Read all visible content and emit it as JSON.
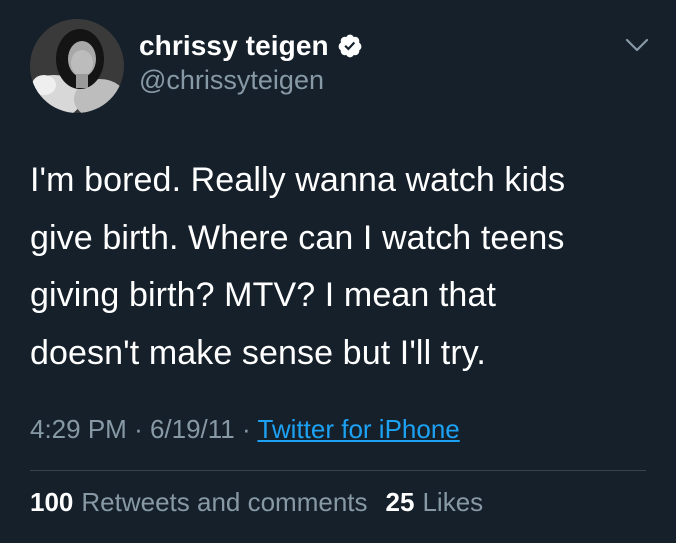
{
  "tweet": {
    "display_name": "chrissy teigen",
    "handle": "@chrissyteigen",
    "verified": true,
    "text": "I'm bored. Really wanna watch kids\ngive birth. Where can I watch teens\ngiving birth? MTV? I mean that\ndoesn't make sense but I'll try.",
    "time": "4:29 PM",
    "date": "6/19/11",
    "separator": "·",
    "source": "Twitter for iPhone",
    "retweets_count": "100",
    "retweets_label": "Retweets and comments",
    "likes_count": "25",
    "likes_label": "Likes"
  },
  "icons": {
    "verified": "verified-badge-icon",
    "menu": "chevron-down-icon"
  },
  "colors": {
    "background": "#15202b",
    "text": "#ffffff",
    "secondary": "#8899a6",
    "link": "#1da1f2",
    "divider": "#38444d"
  }
}
